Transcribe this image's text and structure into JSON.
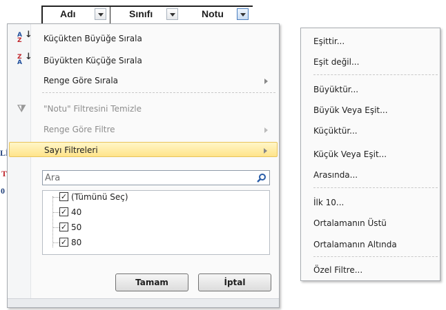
{
  "header": {
    "columns": [
      {
        "label": "Adı"
      },
      {
        "label": "Sınıfı"
      },
      {
        "label": "Notu"
      }
    ]
  },
  "background": {
    "fragment1": "Lİ",
    "fragment2": "T",
    "fragment3": "0"
  },
  "menu": {
    "sort_asc": "Küçükten Büyüğe Sırala",
    "sort_desc": "Büyükten Küçüğe Sırala",
    "sort_color": "Renge Göre Sırala",
    "clear_filter": "\"Notu\" Filtresini Temizle",
    "filter_color": "Renge Göre Filtre",
    "number_filters": "Sayı Filtreleri",
    "search_placeholder": "Ara",
    "tree": [
      "(Tümünü Seç)",
      "40",
      "50",
      "80"
    ],
    "ok": "Tamam",
    "cancel": "İptal"
  },
  "submenu": {
    "items": [
      "Eşittir...",
      "Eşit değil...",
      "Büyüktür...",
      "Büyük Veya Eşit...",
      "Küçüktür...",
      "Küçük Veya Eşit...",
      "Arasında...",
      "İlk 10...",
      "Ortalamanın Üstü",
      "Ortalamanın Altında",
      "Özel Filtre..."
    ]
  },
  "colors": {
    "highlight": "#ffe48a",
    "red_text": "#c0272d",
    "blue_text": "#1f3f7a"
  },
  "icons": [
    "sort-ascending-icon",
    "sort-descending-icon",
    "clear-filter-icon",
    "search-icon",
    "checkbox-icon",
    "dropdown-arrow-icon",
    "submenu-arrow-icon"
  ]
}
